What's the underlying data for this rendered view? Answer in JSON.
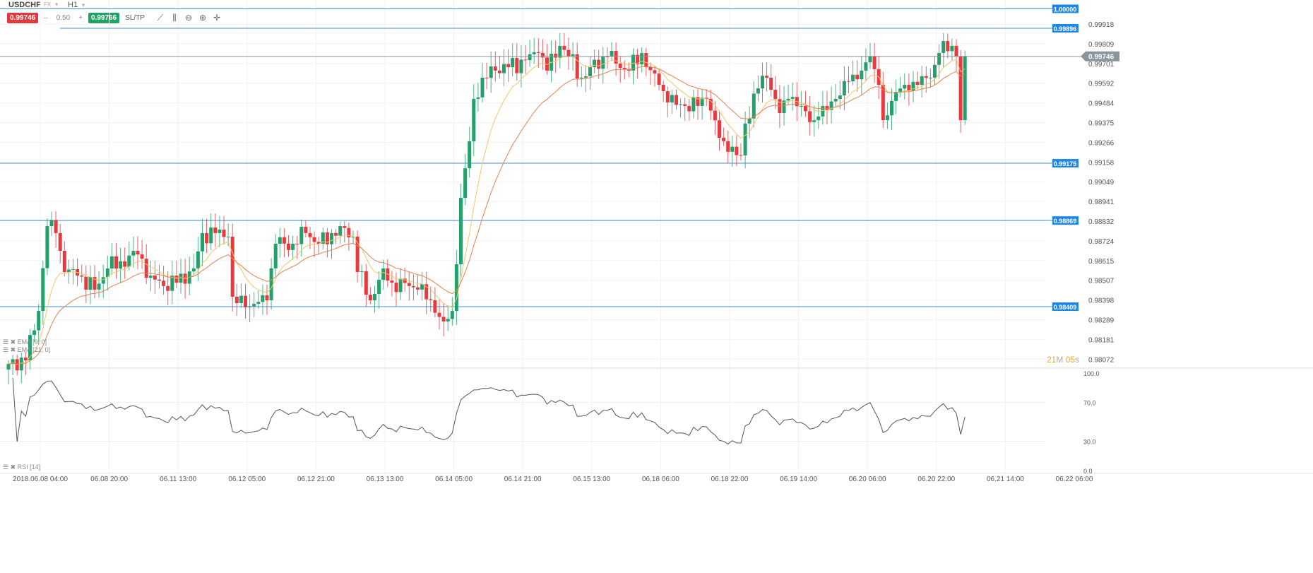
{
  "header": {
    "symbol": "USDCHF",
    "market": "FX",
    "timeframe": "H1"
  },
  "toolbar": {
    "sell_price": "0.99746",
    "spread_minus": "–",
    "spread": "0.50",
    "spread_plus": "+",
    "buy_price": "0.99766",
    "sltp_label": "SL/TP",
    "icons": [
      "line-chart-icon",
      "candles-icon",
      "zoom-out-icon",
      "zoom-in-icon",
      "crosshair-icon"
    ]
  },
  "indicators": {
    "ema1": "EMA [9, 0]",
    "ema2": "EMA [21, 0]",
    "rsi": "RSI [14]"
  },
  "countdown": {
    "minutes": "21",
    "m": "M",
    "seconds": "05",
    "s": "s"
  },
  "colors": {
    "up": "#26a06b",
    "down": "#e8393f",
    "ema1": "#f3c56a",
    "ema2": "#e5814e",
    "hline": "#3d8fd6",
    "hlabel": "#1e88e5",
    "current": "#8c9399"
  },
  "chart_data": {
    "type": "candlestick",
    "symbol": "USDCHF",
    "timeframe": "H1",
    "price_axis_ticks": [
      "0.99918",
      "0.99809",
      "0.99701",
      "0.99592",
      "0.99484",
      "0.99375",
      "0.99266",
      "0.99158",
      "0.99049",
      "0.98941",
      "0.98832",
      "0.98724",
      "0.98615",
      "0.98507",
      "0.98398",
      "0.98289",
      "0.98181",
      "0.98072"
    ],
    "time_axis_ticks": [
      "2018.06.08 04:00",
      "06.08 20:00",
      "06.11 13:00",
      "06.12 05:00",
      "06.12 21:00",
      "06.13 13:00",
      "06.14 05:00",
      "06.14 21:00",
      "06.15 13:00",
      "06.18 06:00",
      "06.18 22:00",
      "06.19 14:00",
      "06.20 06:00",
      "06.20 22:00",
      "06.21 14:00",
      "06.22 06:00"
    ],
    "horizontal_lines": [
      "1.00000",
      "0.99896",
      "0.99175",
      "0.98869",
      "0.98409"
    ],
    "current_price": "0.99746",
    "close_path": [
      [
        0,
        0.98103
      ],
      [
        4,
        0.98122
      ],
      [
        7,
        0.98386
      ],
      [
        9,
        0.98839
      ],
      [
        11,
        0.98802
      ],
      [
        13,
        0.98594
      ],
      [
        16,
        0.98575
      ],
      [
        20,
        0.985
      ],
      [
        23,
        0.98613
      ],
      [
        26,
        0.98651
      ],
      [
        30,
        0.98688
      ],
      [
        33,
        0.98575
      ],
      [
        36,
        0.98519
      ],
      [
        39,
        0.98537
      ],
      [
        43,
        0.98613
      ],
      [
        45,
        0.98802
      ],
      [
        48,
        0.98802
      ],
      [
        51,
        0.98783
      ],
      [
        52,
        0.98462
      ],
      [
        55,
        0.98405
      ],
      [
        57,
        0.98424
      ],
      [
        60,
        0.98443
      ],
      [
        62,
        0.98745
      ],
      [
        66,
        0.98745
      ],
      [
        69,
        0.98802
      ],
      [
        72,
        0.98745
      ],
      [
        75,
        0.98802
      ],
      [
        77,
        0.98839
      ],
      [
        80,
        0.98783
      ],
      [
        81,
        0.98594
      ],
      [
        84,
        0.98443
      ],
      [
        87,
        0.98613
      ],
      [
        89,
        0.98537
      ],
      [
        93,
        0.98519
      ],
      [
        95,
        0.985
      ],
      [
        98,
        0.98443
      ],
      [
        101,
        0.9833
      ],
      [
        103,
        0.98386
      ],
      [
        105,
        0.9899
      ],
      [
        107,
        0.99292
      ],
      [
        108,
        0.99519
      ],
      [
        110,
        0.99632
      ],
      [
        113,
        0.9967
      ],
      [
        116,
        0.99688
      ],
      [
        120,
        0.99726
      ],
      [
        123,
        0.99764
      ],
      [
        125,
        0.9967
      ],
      [
        128,
        0.99802
      ],
      [
        130,
        0.99745
      ],
      [
        133,
        0.99632
      ],
      [
        135,
        0.99688
      ],
      [
        139,
        0.99745
      ],
      [
        141,
        0.99707
      ],
      [
        144,
        0.9967
      ],
      [
        147,
        0.99764
      ],
      [
        148,
        0.99688
      ],
      [
        151,
        0.99594
      ],
      [
        153,
        0.995
      ],
      [
        157,
        0.99481
      ],
      [
        160,
        0.99481
      ],
      [
        162,
        0.99519
      ],
      [
        165,
        0.99311
      ],
      [
        167,
        0.99236
      ],
      [
        170,
        0.99217
      ],
      [
        171,
        0.99387
      ],
      [
        174,
        0.99575
      ],
      [
        176,
        0.99632
      ],
      [
        179,
        0.99443
      ],
      [
        181,
        0.99519
      ],
      [
        184,
        0.99481
      ],
      [
        187,
        0.99405
      ],
      [
        189,
        0.99481
      ],
      [
        193,
        0.99537
      ],
      [
        195,
        0.99613
      ],
      [
        198,
        0.9967
      ],
      [
        200,
        0.99745
      ],
      [
        202,
        0.99594
      ],
      [
        203,
        0.99405
      ],
      [
        206,
        0.99556
      ],
      [
        208,
        0.99594
      ],
      [
        211,
        0.99594
      ],
      [
        214,
        0.99632
      ],
      [
        216,
        0.99764
      ],
      [
        219,
        0.99802
      ],
      [
        220,
        0.99745
      ],
      [
        221,
        0.99405
      ],
      [
        222,
        0.99746
      ]
    ],
    "rsi": {
      "period": 14,
      "ticks": [
        "100.0",
        "70.0",
        "30.0",
        "0.0"
      ]
    }
  }
}
